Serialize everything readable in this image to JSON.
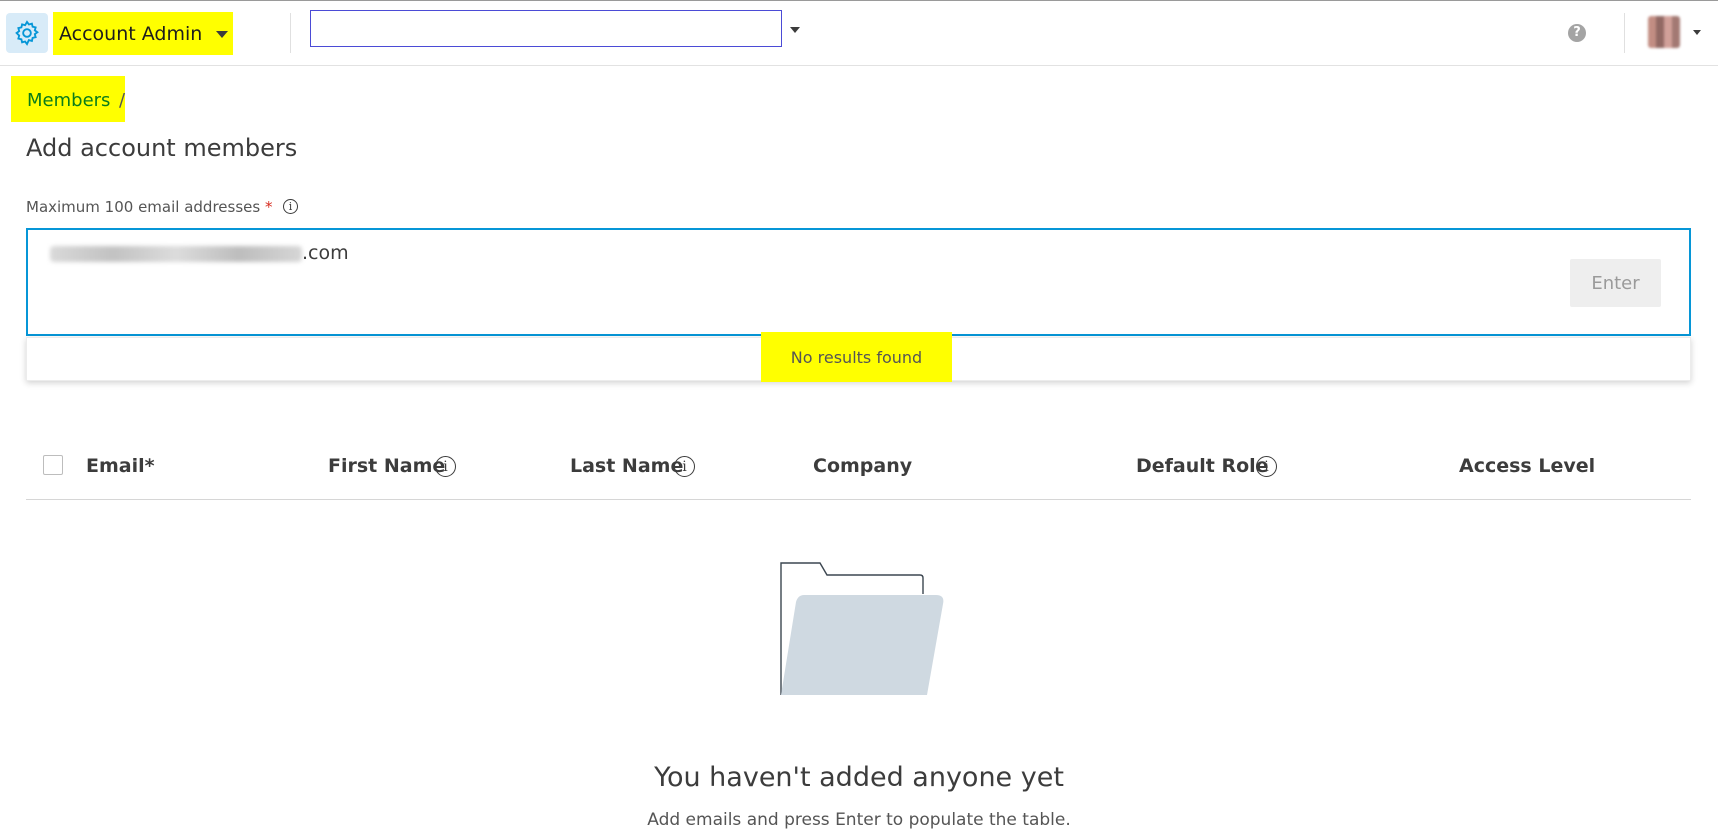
{
  "header": {
    "product_name": "Account Admin",
    "project_selector_value": "",
    "help_label": "?"
  },
  "breadcrumb": {
    "link": "Members",
    "separator": "/"
  },
  "page": {
    "title": "Add account members"
  },
  "email_field": {
    "label": "Maximum 100 email addresses",
    "required_marker": "*",
    "value_visible_suffix": ".com",
    "enter_button_label": "Enter",
    "no_results_text": "No results found"
  },
  "table": {
    "columns": [
      "Email*",
      "First Name",
      "Last Name",
      "Company",
      "Default Role",
      "Access Level"
    ]
  },
  "empty_state": {
    "title": "You haven't added anyone yet",
    "subtitle": "Add emails and press Enter to populate the table."
  },
  "colors": {
    "highlight": "#ffff00",
    "accent": "#0696d7",
    "link": "#0a7d1a",
    "folder_fill": "#cfd9e1"
  },
  "icons": [
    "gear-icon",
    "chevron-down-icon",
    "help-icon",
    "info-icon",
    "folder-icon"
  ]
}
